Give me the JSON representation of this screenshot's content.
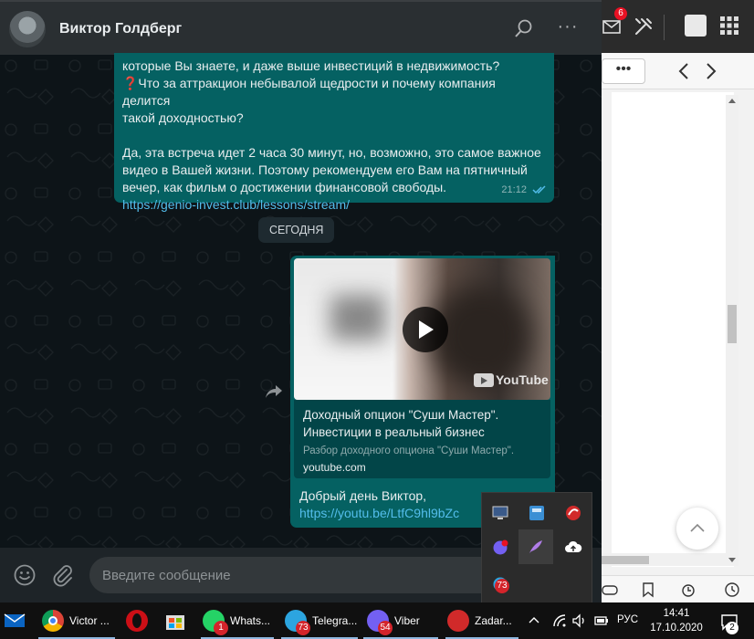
{
  "browser": {
    "mail_badge": "6",
    "more_label": "•••"
  },
  "whatsapp": {
    "contact_name": "Виктор Голдберг",
    "message1": {
      "line1": "которые Вы знаете, и даже выше инвестиций в недвижимость?",
      "line2": "❓Что за аттракцион небывалой щедрости и почему компания делится",
      "line3": "такой доходностью?",
      "line4": "Да, эта встреча идет 2 часа 30 минут, но, возможно, это самое важное",
      "line5": "видео в Вашей жизни. Поэтому рекомендуем его Вам на пятничный",
      "line6": "вечер, как фильм о достижении финансовой свободы.",
      "link": "https://genio-invest.club/lessons/stream/",
      "time": "21:12"
    },
    "date_divider": "СЕГОДНЯ",
    "message2": {
      "video_brand": "YouTube",
      "preview_title_line1": "Доходный опцион \"Суши Мастер\".",
      "preview_title_line2": "Инвестиции в реальный бизнес",
      "preview_description": "Разбор доходного опциона \"Суши Мастер\".",
      "preview_domain": "youtube.com",
      "text": "Добрый день Виктор,",
      "link": "https://youtu.be/LtfC9hl9bZc"
    },
    "composer_placeholder": "Введите сообщение"
  },
  "taskbar": {
    "apps": [
      {
        "label": "Victor ...",
        "icon": "chrome-icon",
        "badge": ""
      },
      {
        "label": "",
        "icon": "opera-icon",
        "badge": ""
      },
      {
        "label": "",
        "icon": "store-icon",
        "badge": ""
      },
      {
        "label": "Whats...",
        "icon": "whatsapp-icon",
        "badge": "1"
      },
      {
        "label": "Telegra...",
        "icon": "telegram-icon",
        "badge": "73"
      },
      {
        "label": "Viber",
        "icon": "viber-icon",
        "badge": "54"
      },
      {
        "label": "Zadar...",
        "icon": "zadarma-icon",
        "badge": ""
      }
    ],
    "language": "РУС",
    "time": "14:41",
    "date": "17.10.2020",
    "notification_count": "2"
  },
  "tray_popup": {
    "telegram_badge": "73"
  },
  "colors": {
    "outgoing_bubble": "#056162",
    "link": "#53bdeb",
    "header": "#2a2f32",
    "taskbar": "#101010"
  }
}
